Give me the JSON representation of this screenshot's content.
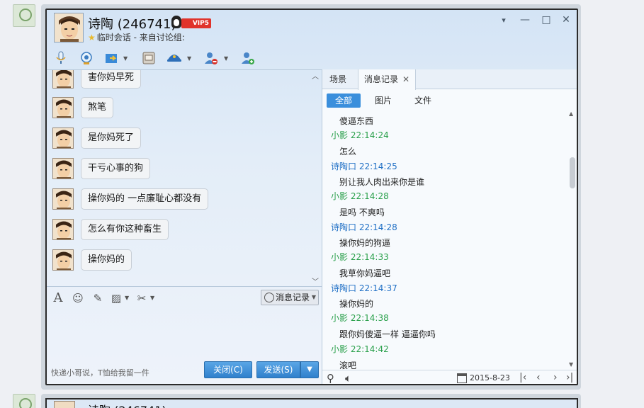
{
  "window": {
    "contact_name": "诗陶  (246741)",
    "vip_badge": "VIP5",
    "subtitle": "临时会话 - 来自讨论组:",
    "controls": [
      "▾",
      "—",
      "□",
      "✕"
    ]
  },
  "toolbar": {
    "buttons": [
      "voice-icon",
      "video-icon",
      "file-transfer-icon",
      "screenshot-icon",
      "app-icon",
      "block-user-icon",
      "add-contact-icon"
    ]
  },
  "chat": {
    "messages": [
      {
        "text": "害你妈早死"
      },
      {
        "text": "煞笔"
      },
      {
        "text": "是你妈死了"
      },
      {
        "text": "干亏心事的狗"
      },
      {
        "text": "操你妈的 一点廉耻心都没有"
      },
      {
        "text": "怎么有你这种畜生"
      },
      {
        "text": "操你妈的"
      }
    ]
  },
  "input_toolbar": {
    "history_label": "消息记录"
  },
  "input": {
    "ad_text": "快递小哥说，T恤给我留一件"
  },
  "buttons": {
    "close": "关闭(C)",
    "send": "发送(S)",
    "send_drop": "▼"
  },
  "right_pane": {
    "tabs": [
      {
        "label": "场景"
      },
      {
        "label": "消息记录"
      }
    ],
    "filters": [
      "全部",
      "图片",
      "文件"
    ],
    "log": [
      {
        "type": "text",
        "value": "傻逼东西"
      },
      {
        "type": "head",
        "color": "green",
        "value": "小影 22:14:24"
      },
      {
        "type": "text",
        "value": "怎么"
      },
      {
        "type": "head",
        "color": "blue",
        "value": "诗陶口 22:14:25"
      },
      {
        "type": "text",
        "value": "别让我人肉出来你是谁"
      },
      {
        "type": "head",
        "color": "green",
        "value": "小影 22:14:28"
      },
      {
        "type": "text",
        "value": "是吗 不爽吗"
      },
      {
        "type": "head",
        "color": "blue",
        "value": "诗陶口 22:14:28"
      },
      {
        "type": "text",
        "value": "操你妈的狗逼"
      },
      {
        "type": "head",
        "color": "green",
        "value": "小影 22:14:33"
      },
      {
        "type": "text",
        "value": "我草你妈逼吧"
      },
      {
        "type": "head",
        "color": "blue",
        "value": "诗陶口 22:14:37"
      },
      {
        "type": "text",
        "value": "操你妈的"
      },
      {
        "type": "head",
        "color": "green",
        "value": "小影 22:14:38"
      },
      {
        "type": "text",
        "value": "跟你妈傻逼一样 逼逼你吗"
      },
      {
        "type": "head",
        "color": "green",
        "value": "小影 22:14:42"
      },
      {
        "type": "text",
        "value": "滚吧"
      }
    ],
    "date": "2015-8-23",
    "colors": {
      "green": "#2aa04b",
      "blue": "#1f6fc5",
      "accent": "#3b8fdc"
    }
  },
  "second_window": {
    "contact_name": "诗陶  (246741)"
  }
}
